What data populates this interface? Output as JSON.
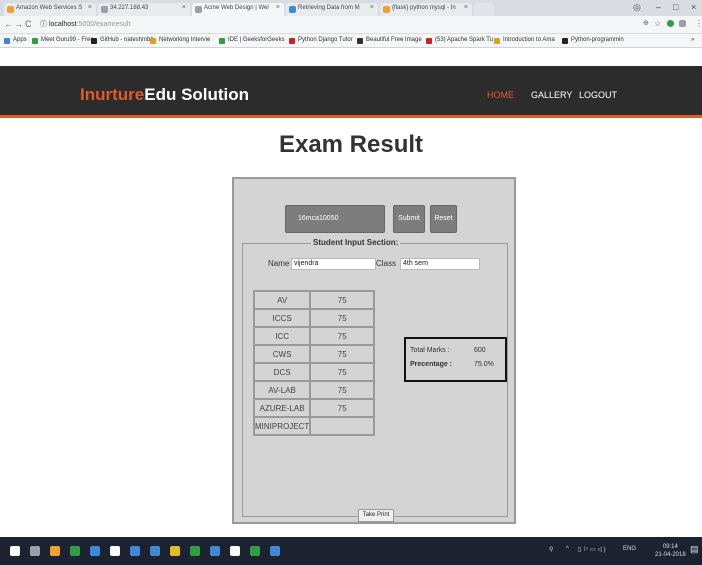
{
  "browser": {
    "tabs": [
      {
        "label": "Amazon Web Services S",
        "color": "#f0a030"
      },
      {
        "label": "34.227.188.43",
        "color": "#9aa0a6"
      },
      {
        "label": "Acme Web Design | Wel",
        "color": "#9aa0a6"
      },
      {
        "label": "Retrieving Data from M",
        "color": "#3c8ad8"
      },
      {
        "label": "{flask} python mysql - In",
        "color": "#f0a030"
      }
    ],
    "url_host": "localhost",
    "url_path": ":5000/examresult",
    "bookmarks": [
      {
        "label": "Apps",
        "color": "#4a7fd8"
      },
      {
        "label": "Meet Guru99 - Free",
        "color": "#2f9e44"
      },
      {
        "label": "GitHub - nateshmbh",
        "color": "#222222"
      },
      {
        "label": "Networking Intervie",
        "color": "#e0a020"
      },
      {
        "label": "IDE | GeeksforGeeks",
        "color": "#2f9e44"
      },
      {
        "label": "Python Django Tutor",
        "color": "#d02020"
      },
      {
        "label": "Beautiful Free Image",
        "color": "#333333"
      },
      {
        "label": "(53) Apache Spark Tu",
        "color": "#d02020"
      },
      {
        "label": "Introduction to Ama",
        "color": "#e0a020"
      },
      {
        "label": "Python-programmin",
        "color": "#222222"
      }
    ]
  },
  "site": {
    "logo_accent": "Inurture",
    "logo_rest": "Edu Solution",
    "nav": [
      {
        "label": "HOME",
        "active": true
      },
      {
        "label": "GALLERY",
        "active": false
      },
      {
        "label": "LOGOUT",
        "active": false
      }
    ],
    "accent_color": "#e25a2a"
  },
  "page": {
    "title": "Exam Result",
    "roll_value": "16mca10050",
    "submit_label": "Submit",
    "reset_label": "Reset",
    "section_legend": "Student Input Section:",
    "name_label": "Name",
    "name_value": "vijendra",
    "class_label": "Class",
    "class_value": "4th sem",
    "marks": [
      {
        "subject": "AV",
        "score": "75"
      },
      {
        "subject": "ICCS",
        "score": "75"
      },
      {
        "subject": "ICC",
        "score": "75"
      },
      {
        "subject": "CWS",
        "score": "75"
      },
      {
        "subject": "DCS",
        "score": "75"
      },
      {
        "subject": "AV-LAB",
        "score": "75"
      },
      {
        "subject": "AZURE-LAB",
        "score": "75"
      },
      {
        "subject": "MINIPROJECT",
        "score": ""
      }
    ],
    "total_label": "Total Marks :",
    "total_value": "600",
    "percentage_label": "Precentage :",
    "percentage_value": "75.0%",
    "print_label": "Take Print"
  },
  "taskbar": {
    "apps": [
      "#ffffff",
      "#9aa0a6",
      "#f0a030",
      "#2f9e44",
      "#3c8ad8",
      "#ffffff",
      "#3c8ad8",
      "#3c8ad8",
      "#e0c020",
      "#2f9e44",
      "#3c8ad8",
      "#ffffff",
      "#2f9e44",
      "#3c8ad8"
    ],
    "lang": "ENG",
    "time": "09:14",
    "date": "21-04-2018"
  }
}
